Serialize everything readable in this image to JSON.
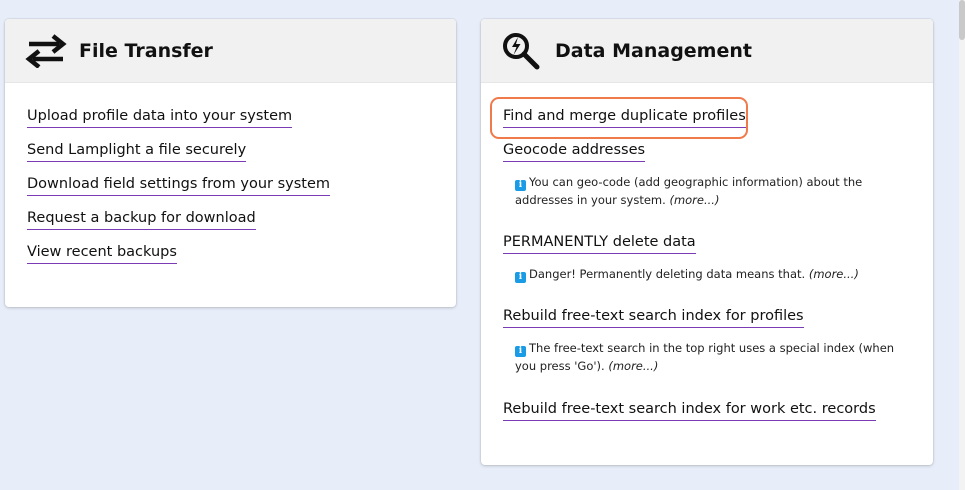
{
  "file_transfer": {
    "title": "File Transfer",
    "icon": "transfer-arrows-icon",
    "links": [
      "Upload profile data into your system",
      "Send Lamplight a file securely",
      "Download field settings from your system",
      "Request a backup for download",
      "View recent backups"
    ]
  },
  "data_management": {
    "title": "Data Management",
    "icon": "search-lightning-icon",
    "items": [
      {
        "label": "Find and merge duplicate profiles"
      },
      {
        "label": "Geocode addresses",
        "info_line1": "You can geo-code (add geographic information) about the",
        "info_line2": "addresses in your system.",
        "more": "(more...)"
      },
      {
        "label": "PERMANENTLY delete data",
        "info_line1": "Danger! Permanently deleting data means that.",
        "more": "(more...)"
      },
      {
        "label": "Rebuild free-text search index for profiles",
        "info_line1": "The free-text search in the top right uses a special index (when",
        "info_line2": "you press 'Go').",
        "more": "(more...)"
      },
      {
        "label": "Rebuild free-text search index for work etc. records"
      }
    ]
  },
  "colors": {
    "background": "#e8eef9",
    "link_underline": "#7b3bb5",
    "highlight": "#f07a4a",
    "info_icon": "#1a9be6"
  }
}
